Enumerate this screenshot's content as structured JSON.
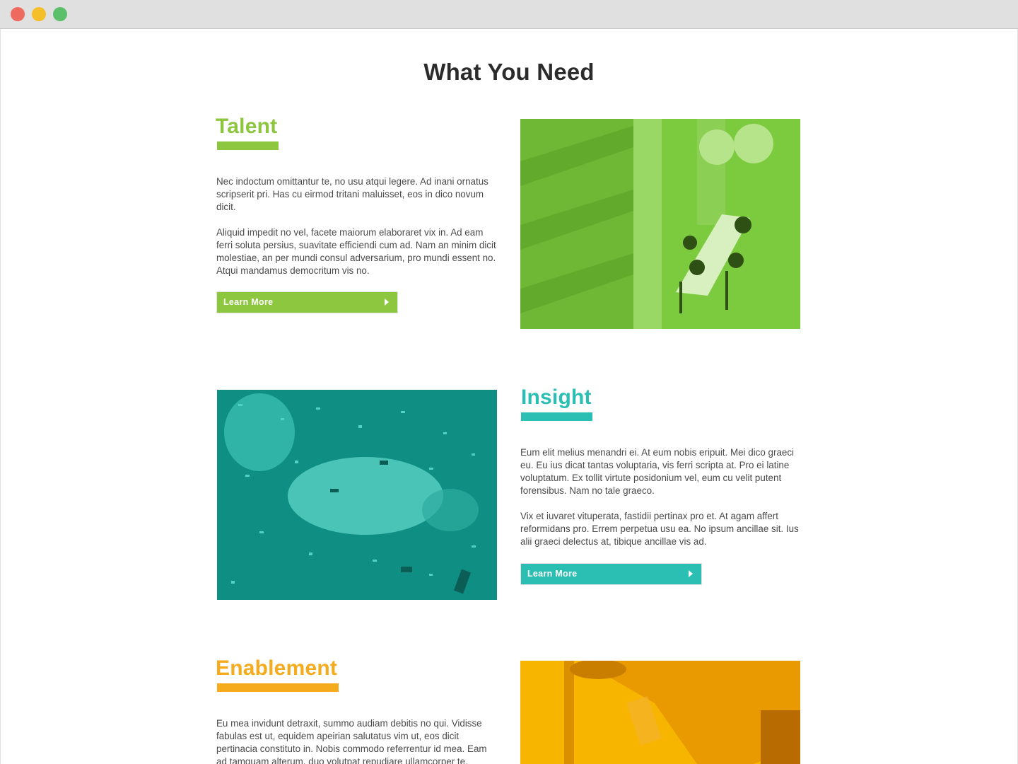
{
  "page": {
    "title": "What You Need"
  },
  "colors": {
    "talent": "#8dc63f",
    "insight": "#2bbfb3",
    "enablement": "#f5ab1b"
  },
  "sections": {
    "talent": {
      "heading": "Talent",
      "paragraphs": [
        "Nec indoctum omittantur te, no usu atqui legere. Ad inani ornatus scripserit pri. Has cu eirmod tritani maluisset, eos in dico novum dicit.",
        "Aliquid impedit no vel, facete maiorum elaboraret vix in. Ad eam ferri soluta persius, suavitate efficiendi cum ad. Nam an minim dicit molestiae, an per mundi consul adversarium, pro mundi essent no. Atqui mandamus democritum vis no."
      ],
      "button_label": "Learn More",
      "image_icon": "office-meeting-photo"
    },
    "insight": {
      "heading": "Insight",
      "paragraphs": [
        "Eum elit melius menandri ei. At eum nobis eripuit. Mei dico graeci eu. Eu ius dicat tantas voluptaria, vis ferri scripta at. Pro ei latine voluptatum. Ex tollit virtute posidonium vel, eum cu velit putent forensibus. Nam no tale graeco.",
        "Vix et iuvaret vituperata, fastidii pertinax pro et. At agam affert reformidans pro. Errem perpetua usu ea. No ipsum ancillae sit. Ius alii graeci delectus at, tibique ancillae vis ad."
      ],
      "button_label": "Learn More",
      "image_icon": "confetti-photo"
    },
    "enablement": {
      "heading": "Enablement",
      "paragraphs": [
        "Eu mea invidunt detraxit, summo audiam debitis no qui. Vidisse fabulas est ut, equidem apeirian salutatus vim ut, eos dicit pertinacia constituto in. Nobis commodo referrentur id mea. Eam ad tamquam alterum, duo volutpat repudiare ullamcorper te."
      ],
      "image_icon": "hand-reaching-photo"
    }
  }
}
